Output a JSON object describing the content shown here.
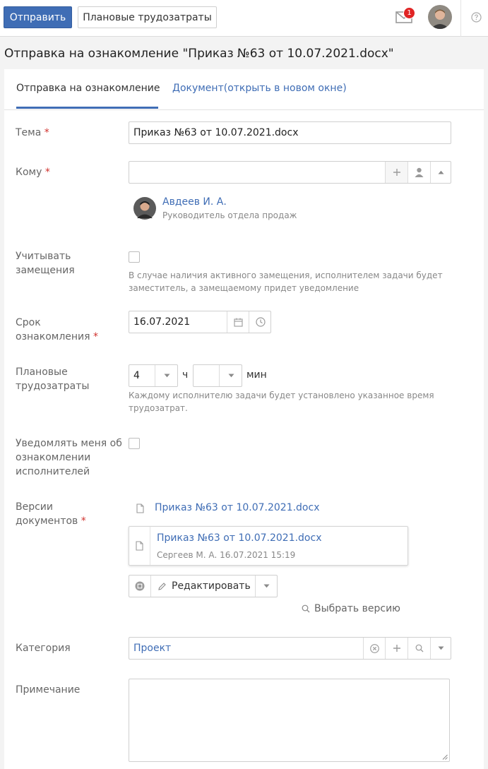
{
  "toolbar": {
    "send_label": "Отправить",
    "planned_label": "Плановые трудозатраты",
    "notification_count": "1"
  },
  "page": {
    "title": "Отправка на ознакомление \"Приказ №63 от 10.07.2021.docx\""
  },
  "tabs": [
    {
      "label": "Отправка на ознакомление"
    },
    {
      "label": "Документ(открыть в новом окне)"
    }
  ],
  "form": {
    "subject": {
      "label": "Тема",
      "value": "Приказ №63 от 10.07.2021.docx"
    },
    "to": {
      "label": "Кому",
      "value": "",
      "recipient_name": "Авдеев И. А.",
      "recipient_role": "Руководитель отдела продаж"
    },
    "substitution": {
      "label_line1": "Учитывать",
      "label_line2": "замещения",
      "hint_line1": "В случае наличия активного замещения, исполнителем задачи будет",
      "hint_line2": "заместитель, а замещаемому придет уведомление"
    },
    "deadline": {
      "label_line1": "Срок",
      "label_line2": "ознакомления",
      "value": "16.07.2021"
    },
    "effort": {
      "label_line1": "Плановые",
      "label_line2": "трудозатраты",
      "hours": "4",
      "hours_unit": "ч",
      "minutes": "",
      "minutes_unit": "мин",
      "hint_line1": "Каждому исполнителю задачи будет установлено указанное время",
      "hint_line2": "трудозатрат."
    },
    "notify": {
      "label_line1": "Уведомлять меня об",
      "label_line2": "ознакомлении",
      "label_line3": "исполнителей"
    },
    "versions": {
      "label_line1": "Версии",
      "label_line2": "документов",
      "doc_link": "Приказ №63 от 10.07.2021.docx",
      "card_title": "Приказ №63 от 10.07.2021.docx",
      "card_meta": "Сергеев М. А. 16.07.2021 15:19",
      "edit_label": "Редактировать",
      "choose_version": "Выбрать версию"
    },
    "category": {
      "label": "Категория",
      "value": "Проект"
    },
    "note": {
      "label": "Примечание",
      "value": ""
    }
  },
  "colors": {
    "accent": "#3f6db5",
    "required": "#d0312d",
    "badge": "#e02424"
  }
}
